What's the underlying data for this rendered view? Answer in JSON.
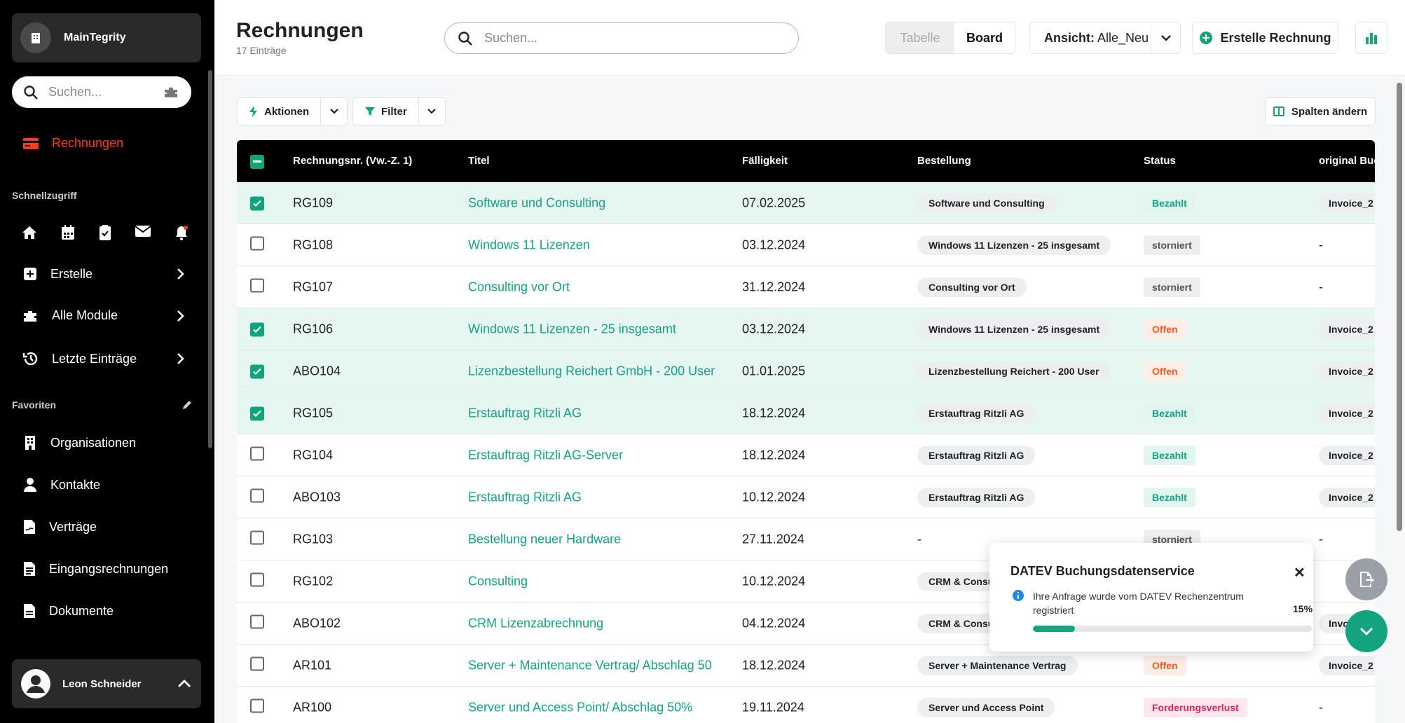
{
  "sidebar": {
    "org_name": "MainTegrity",
    "search_placeholder": "Suchen...",
    "active_item": "Rechnungen",
    "quick_access_label": "Schnellzugriff",
    "quick_icons": [
      "home-icon",
      "calendar-icon",
      "clipboard-icon",
      "mail-icon",
      "bell-icon"
    ],
    "menu": [
      {
        "label": "Erstelle",
        "icon": "plus-square-icon"
      },
      {
        "label": "Alle Module",
        "icon": "puzzle-icon"
      },
      {
        "label": "Letzte Einträge",
        "icon": "history-icon"
      }
    ],
    "favorites_label": "Favoriten",
    "favorites": [
      {
        "label": "Organisationen",
        "icon": "building-icon"
      },
      {
        "label": "Kontakte",
        "icon": "person-icon"
      },
      {
        "label": "Verträge",
        "icon": "contract-icon"
      },
      {
        "label": "Eingangsrechnungen",
        "icon": "document-icon"
      },
      {
        "label": "Dokumente",
        "icon": "file-icon"
      }
    ],
    "user_name": "Leon Schneider"
  },
  "header": {
    "title": "Rechnungen",
    "subtitle": "17 Einträge",
    "search_placeholder": "Suchen...",
    "view_toggle": {
      "table": "Tabelle",
      "board": "Board"
    },
    "view_label": "Ansicht:",
    "view_value": "Alle_Neu",
    "create_button": "Erstelle Rechnung"
  },
  "toolbar": {
    "actions": "Aktionen",
    "filter": "Filter",
    "columns": "Spalten ändern"
  },
  "table": {
    "columns": [
      "Rechnungsnr. (Vw.-Z. 1)",
      "Titel",
      "Fälligkeit",
      "Bestellung",
      "Status",
      "original Buc"
    ],
    "rows": [
      {
        "checked": true,
        "nr": "RG109",
        "title": "Software und Consulting",
        "due": "07.02.2025",
        "order": "Software und Consulting",
        "status": "Bezahlt",
        "status_type": "paid",
        "orig": "Invoice_2"
      },
      {
        "checked": false,
        "nr": "RG108",
        "title": "Windows 11 Lizenzen",
        "due": "03.12.2024",
        "order": "Windows 11 Lizenzen - 25 insgesamt",
        "status": "storniert",
        "status_type": "canc",
        "orig": "-"
      },
      {
        "checked": false,
        "nr": "RG107",
        "title": "Consulting vor Ort",
        "due": "31.12.2024",
        "order": "Consulting vor Ort",
        "status": "storniert",
        "status_type": "canc",
        "orig": "-"
      },
      {
        "checked": true,
        "nr": "RG106",
        "title": "Windows 11 Lizenzen - 25 insgesamt",
        "due": "03.12.2024",
        "order": "Windows 11 Lizenzen - 25 insgesamt",
        "status": "Offen",
        "status_type": "open",
        "orig": "Invoice_2"
      },
      {
        "checked": true,
        "nr": "ABO104",
        "title": "Lizenzbestellung Reichert GmbH - 200 User",
        "due": "01.01.2025",
        "order": "Lizenzbestellung Reichert - 200 User",
        "status": "Offen",
        "status_type": "open",
        "orig": "Invoice_2"
      },
      {
        "checked": true,
        "nr": "RG105",
        "title": "Erstauftrag Ritzli AG",
        "due": "18.12.2024",
        "order": "Erstauftrag Ritzli AG",
        "status": "Bezahlt",
        "status_type": "paid",
        "orig": "Invoice_2"
      },
      {
        "checked": false,
        "nr": "RG104",
        "title": "Erstauftrag Ritzli AG-Server",
        "due": "18.12.2024",
        "order": "Erstauftrag Ritzli AG",
        "status": "Bezahlt",
        "status_type": "paid",
        "orig": "Invoice_2"
      },
      {
        "checked": false,
        "nr": "ABO103",
        "title": "Erstauftrag Ritzli AG",
        "due": "10.12.2024",
        "order": "Erstauftrag Ritzli AG",
        "status": "Bezahlt",
        "status_type": "paid",
        "orig": "Invoice_2"
      },
      {
        "checked": false,
        "nr": "RG103",
        "title": "Bestellung neuer Hardware",
        "due": "27.11.2024",
        "order": "-",
        "status": "storniert",
        "status_type": "canc",
        "orig": "-"
      },
      {
        "checked": false,
        "nr": "RG102",
        "title": "Consulting",
        "due": "10.12.2024",
        "order": "CRM & Consu",
        "status": "",
        "status_type": "",
        "orig": ""
      },
      {
        "checked": false,
        "nr": "ABO102",
        "title": "CRM Lizenzabrechnung",
        "due": "04.12.2024",
        "order": "CRM & Consu",
        "status": "",
        "status_type": "",
        "orig": "Invo"
      },
      {
        "checked": false,
        "nr": "AR101",
        "title": "Server + Maintenance Vertrag/ Abschlag 50",
        "due": "18.12.2024",
        "order": "Server + Maintenance Vertrag",
        "status": "Offen",
        "status_type": "open",
        "orig": "Invoice_2"
      },
      {
        "checked": false,
        "nr": "AR100",
        "title": "Server und Access Point/ Abschlag 50%",
        "due": "19.11.2024",
        "order": "Server und Access Point",
        "status": "Forderungsverlust",
        "status_type": "loss",
        "orig": "-"
      }
    ]
  },
  "toast": {
    "title": "DATEV Buchungsdatenservice",
    "message": "Ihre Anfrage wurde vom DATEV Rechenzentrum registriert",
    "percent_label": "15%",
    "progress": 0.15
  },
  "colors": {
    "accent": "#14a37f",
    "active_nav": "#ff3b1f"
  }
}
